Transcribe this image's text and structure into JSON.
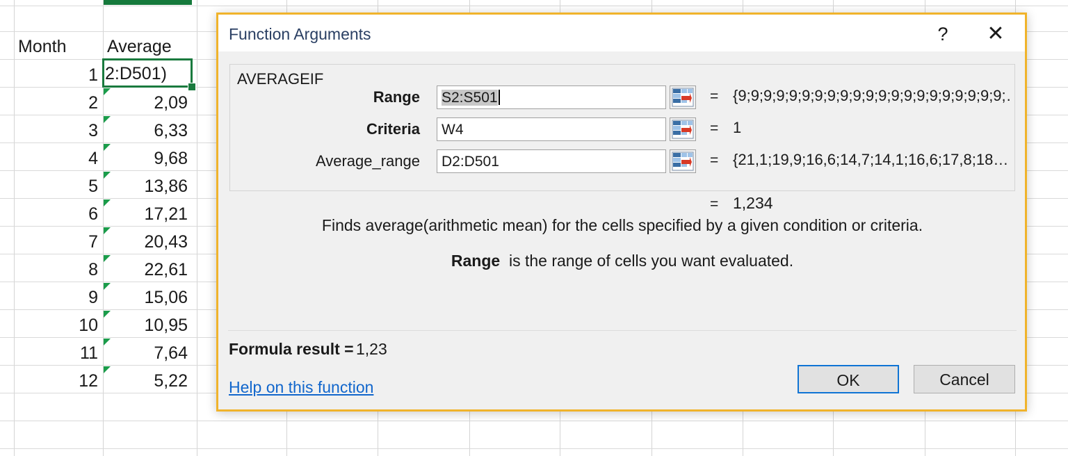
{
  "spreadsheet": {
    "headers": {
      "month": "Month",
      "average": "Average"
    },
    "active_cell": {
      "display_text": "2:D501)",
      "fill_handle": "fill-handle"
    },
    "rows": [
      {
        "month": "1",
        "average": ""
      },
      {
        "month": "2",
        "average": "2,09"
      },
      {
        "month": "3",
        "average": "6,33"
      },
      {
        "month": "4",
        "average": "9,68"
      },
      {
        "month": "5",
        "average": "13,86"
      },
      {
        "month": "6",
        "average": "17,21"
      },
      {
        "month": "7",
        "average": "20,43"
      },
      {
        "month": "8",
        "average": "22,61"
      },
      {
        "month": "9",
        "average": "15,06"
      },
      {
        "month": "10",
        "average": "10,95"
      },
      {
        "month": "11",
        "average": "7,64"
      },
      {
        "month": "12",
        "average": "5,22"
      }
    ],
    "colors": {
      "selection": "#1a7a3e",
      "column_highlight": "#167a3c",
      "error_triangle": "#1a9c4a",
      "gridline": "#d4d4d4"
    }
  },
  "dialog": {
    "title": "Function Arguments",
    "help_button": "?",
    "close_button": "✕",
    "function_name": "AVERAGEIF",
    "arguments": [
      {
        "label": "Range",
        "value": "S2:S501",
        "selected": true,
        "preview": "{9;9;9;9;9;9;9;9;9;9;9;9;9;9;9;9;9;9;9;9;9;…",
        "equals": "=",
        "picker": "range-picker-icon"
      },
      {
        "label": "Criteria",
        "value": "W4",
        "selected": false,
        "preview": "1",
        "equals": "=",
        "picker": "range-picker-icon"
      },
      {
        "label": "Average_range",
        "value": "D2:D501",
        "selected": false,
        "preview": "{21,1;19,9;16,6;14,7;14,1;16,6;17,8;18…",
        "equals": "=",
        "picker": "range-picker-icon"
      }
    ],
    "result_equals": "=",
    "result_preview": "1,234",
    "description_main": "Finds average(arithmetic mean) for the cells specified by a given condition or criteria.",
    "description_arg_name": "Range",
    "description_arg_text": "is the range of cells you want evaluated.",
    "formula_result_label": "Formula result =",
    "formula_result_value": "1,23",
    "help_link": "Help on this function",
    "ok_button": "OK",
    "cancel_button": "Cancel",
    "colors": {
      "border": "#f0b32b",
      "focus": "#0f74d4",
      "link": "#1166cc",
      "title_text": "#2a3f63"
    }
  }
}
